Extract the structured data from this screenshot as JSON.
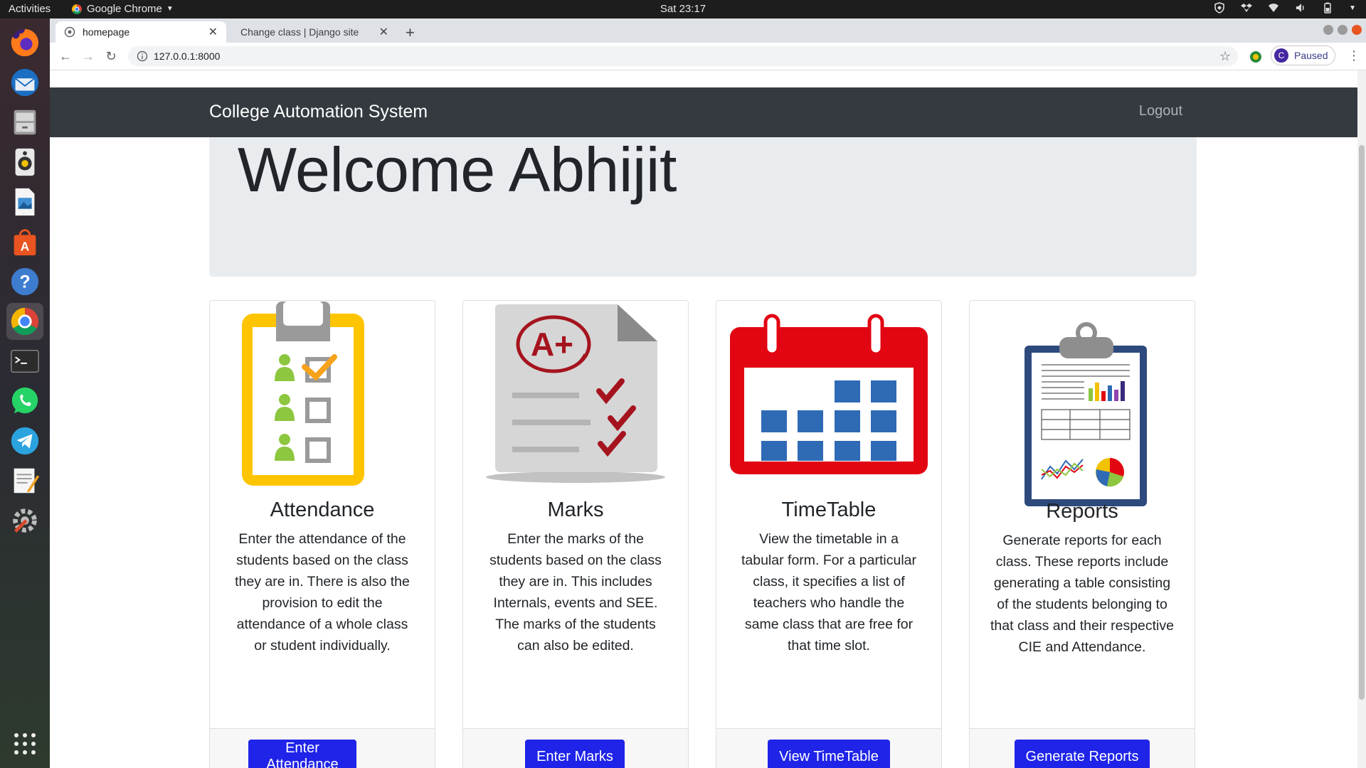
{
  "topbar": {
    "activities": "Activities",
    "app_name": "Google Chrome",
    "clock": "Sat 23:17"
  },
  "tabs": [
    {
      "title": "homepage",
      "active": true
    },
    {
      "title": "Change class | Django site",
      "active": false
    }
  ],
  "toolbar": {
    "url": "127.0.0.1:8000",
    "profile_initial": "C",
    "profile_status": "Paused"
  },
  "navbar": {
    "brand": "College Automation System",
    "logout": "Logout"
  },
  "jumbotron": {
    "heading": "Welcome Abhijit"
  },
  "cards": [
    {
      "title": "Attendance",
      "text": "Enter the attendance of the students based on the class they are in. There is also the provision to edit the attendance of a whole class or student individually.",
      "button": "Enter Attendance"
    },
    {
      "title": "Marks",
      "text": "Enter the marks of the students based on the class they are in. This includes Internals, events and SEE. The marks of the students can also be edited.",
      "button": "Enter Marks"
    },
    {
      "title": "TimeTable",
      "text": "View the timetable in a tabular form. For a particular class, it specifies a list of teachers who handle the same class that are free for that time slot.",
      "button": "View TimeTable"
    },
    {
      "title": "Reports",
      "text": "Generate reports for each class. These reports include generating a table consisting of the students belonging to that class and their respective CIE and Attendance.",
      "button": "Generate Reports"
    }
  ],
  "colors": {
    "navbar_bg": "#343a40",
    "jumbotron_bg": "#e9ecef",
    "button_bg": "#1f24e8",
    "attendance_yellow": "#ffc400",
    "timetable_red": "#e20613",
    "timetable_blue": "#2f6ab5",
    "marks_red": "#a5141e"
  }
}
